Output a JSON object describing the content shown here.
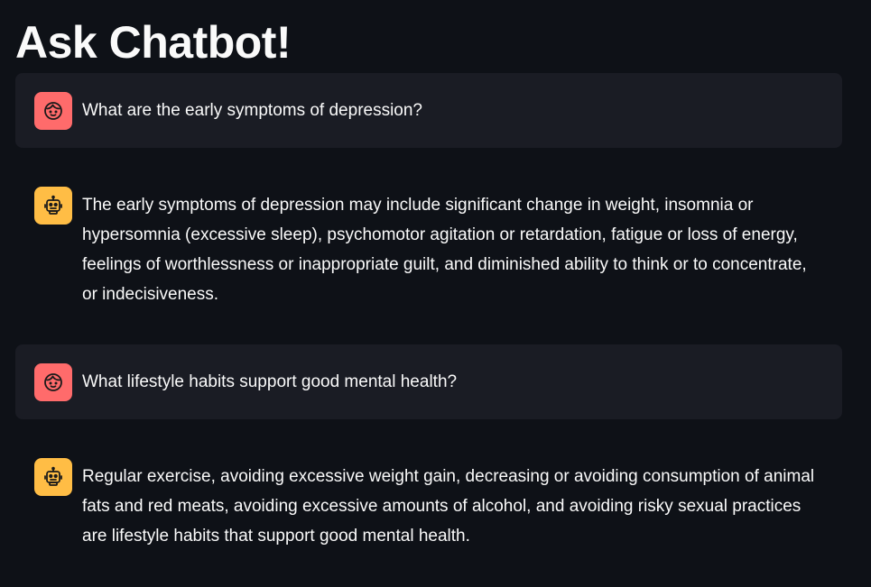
{
  "page": {
    "title": "Ask Chatbot!"
  },
  "colors": {
    "background": "#0e1117",
    "user_bubble": "#1a1c24",
    "user_avatar": "#ff6b6b",
    "assistant_avatar": "#ffbd45",
    "text": "#fafafa"
  },
  "messages": [
    {
      "role": "user",
      "avatar_icon": "user-face-icon",
      "text": "What are the early symptoms of depression?"
    },
    {
      "role": "assistant",
      "avatar_icon": "robot-icon",
      "text": "The early symptoms of depression may include significant change in weight, insomnia or hypersomnia (excessive sleep), psychomotor agitation or retardation, fatigue or loss of energy, feelings of worthlessness or inappropriate guilt, and diminished ability to think or to concentrate, or indecisiveness."
    },
    {
      "role": "user",
      "avatar_icon": "user-face-icon",
      "text": "What lifestyle habits support good mental health?"
    },
    {
      "role": "assistant",
      "avatar_icon": "robot-icon",
      "text": "Regular exercise, avoiding excessive weight gain, decreasing or avoiding consumption of animal fats and red meats, avoiding excessive amounts of alcohol, and avoiding risky sexual practices are lifestyle habits that support good mental health."
    }
  ]
}
